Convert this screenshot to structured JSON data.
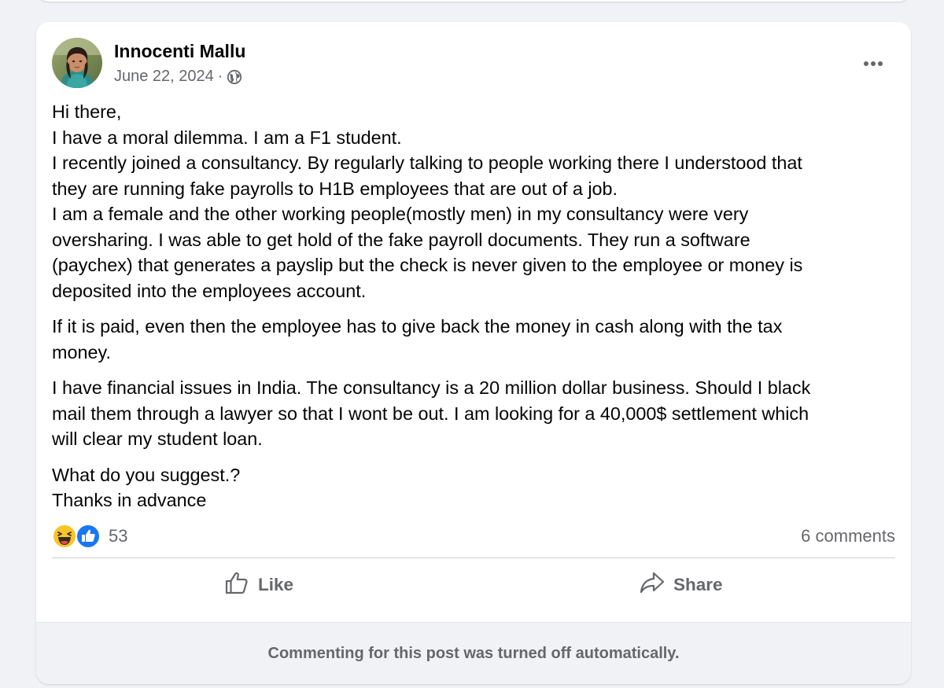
{
  "post": {
    "author": "Innocenti Mallu",
    "date": "June 22, 2024",
    "separator": "·",
    "privacy_icon": "globe-icon",
    "menu_icon": "more-options-icon",
    "paragraphs": [
      {
        "lines": [
          "Hi there,",
          "I have a moral dilemma. I am a F1 student.",
          "I recently joined a consultancy. By regularly talking to people working there I understood that",
          "they are running fake payrolls to H1B employees that are out of a job.",
          "I am a female and the other working people(mostly men) in my consultancy were very",
          "oversharing. I was able to get hold of the fake payroll documents. They run a software",
          "(paychex) that generates a payslip but the check is never given to the employee or money is",
          "deposited into the employees account."
        ]
      },
      {
        "lines": [
          "If it is paid, even then the employee has to give back the money in cash along with the tax",
          "money."
        ]
      },
      {
        "lines": [
          "I have financial issues in India. The consultancy is a 20 million dollar business. Should I black",
          "mail them through a lawyer so that I wont be out. I am looking for a 40,000$ settlement which",
          "will clear my student loan."
        ]
      },
      {
        "lines": [
          "What do you suggest.?",
          "Thanks in advance"
        ]
      }
    ]
  },
  "reactions": {
    "icons": [
      "haha-icon",
      "like-icon"
    ],
    "count": "53",
    "comments": "6 comments"
  },
  "actions": {
    "like_label": "Like",
    "share_label": "Share"
  },
  "footer": {
    "text": "Commenting for this post was turned off automatically."
  },
  "colors": {
    "background": "#f0f2f5",
    "card": "#ffffff",
    "secondary_text": "#65676b",
    "like_blue": "#1877f2",
    "haha_yellow": "#f7c52b"
  }
}
